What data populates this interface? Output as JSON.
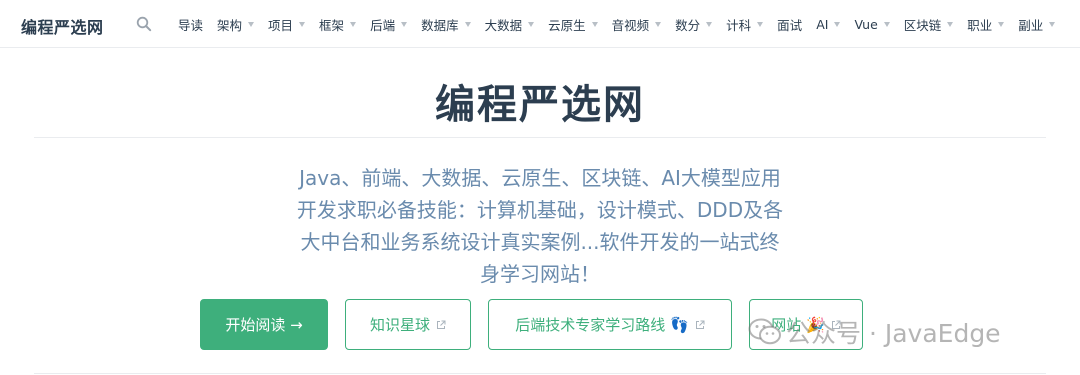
{
  "header": {
    "site_name": "编程严选网",
    "nav": [
      {
        "label": "导读",
        "has_arrow": false
      },
      {
        "label": "架构",
        "has_arrow": true
      },
      {
        "label": "项目",
        "has_arrow": true
      },
      {
        "label": "框架",
        "has_arrow": true
      },
      {
        "label": "后端",
        "has_arrow": true
      },
      {
        "label": "数据库",
        "has_arrow": true
      },
      {
        "label": "大数据",
        "has_arrow": true
      },
      {
        "label": "云原生",
        "has_arrow": true
      },
      {
        "label": "音视频",
        "has_arrow": true
      },
      {
        "label": "数分",
        "has_arrow": true
      },
      {
        "label": "计科",
        "has_arrow": true
      },
      {
        "label": "面试",
        "has_arrow": false
      },
      {
        "label": "AI",
        "has_arrow": true
      },
      {
        "label": "Vue",
        "has_arrow": true
      },
      {
        "label": "区块链",
        "has_arrow": true
      },
      {
        "label": "职业",
        "has_arrow": true
      },
      {
        "label": "副业",
        "has_arrow": true
      }
    ]
  },
  "hero": {
    "title": "编程严选网",
    "description": "Java、前端、大数据、云原生、区块链、AI大模型应用开发求职必备技能：计算机基础，设计模式、DDD及各大中台和业务系统设计真实案例...软件开发的一站式终身学习网站！"
  },
  "actions": {
    "start": "开始阅读 →",
    "planet": "知识星球",
    "roadmap": "后端技术专家学习路线 👣",
    "website": "网站 🎉"
  },
  "watermark": {
    "text": "公众号 · JavaEdge",
    "icon": "wechat-icon"
  },
  "colors": {
    "accent": "#3eaf7c",
    "text": "#2c3e50",
    "description": "#6a8bad"
  }
}
